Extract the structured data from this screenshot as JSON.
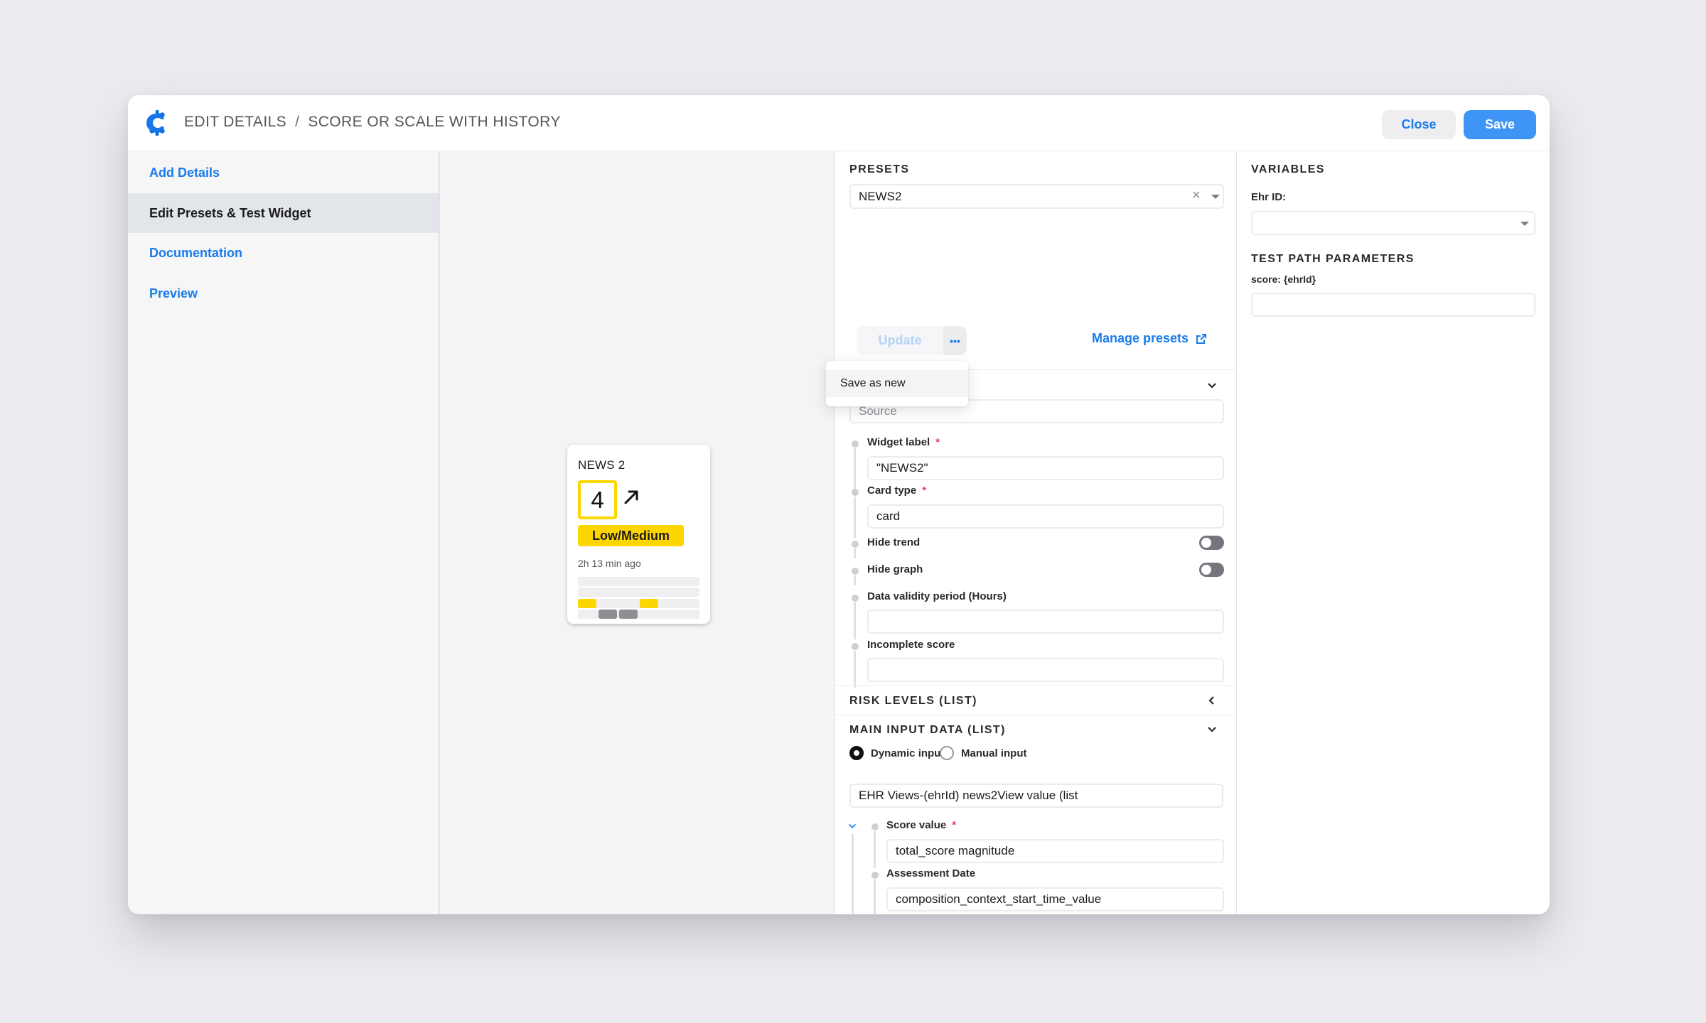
{
  "header": {
    "breadcrumb": [
      "EDIT DETAILS",
      "SCORE OR SCALE WITH HISTORY"
    ],
    "separator": "/",
    "close_label": "Close",
    "save_label": "Save"
  },
  "sidebar": {
    "items": [
      {
        "label": "Add Details",
        "active": false
      },
      {
        "label": "Edit Presets & Test Widget",
        "active": true
      },
      {
        "label": "Documentation",
        "active": false
      },
      {
        "label": "Preview",
        "active": false
      }
    ]
  },
  "preview_card": {
    "title": "NEWS 2",
    "score": "4",
    "trend": "up",
    "risk_label": "Low/Medium",
    "risk_color": "#fdd600",
    "time_ago": "2h 13 min ago",
    "history_marks_color": "#fdd600",
    "history_grey_color": "#8e8f95"
  },
  "presets": {
    "title": "PRESETS",
    "selected": "NEWS2",
    "update_label": "Update",
    "more_label": "•••",
    "manage_label": "Manage presets",
    "menu_items": [
      "Save as new"
    ]
  },
  "config": {
    "source_placeholder": "Source",
    "fields": [
      {
        "label": "Widget label",
        "required": true,
        "value": "\"NEWS2\""
      },
      {
        "label": "Card type",
        "required": true,
        "value": "card"
      }
    ],
    "toggles": [
      {
        "label": "Hide trend",
        "on": false
      },
      {
        "label": "Hide graph",
        "on": false
      }
    ],
    "data_validity_label": "Data validity period (Hours)",
    "data_validity_value": "",
    "incomplete_score_label": "Incomplete score",
    "incomplete_score_value": "",
    "risk_levels_title": "RISK LEVELS (LIST)",
    "main_input_title": "MAIN INPUT DATA (LIST)",
    "radio_options": [
      {
        "label": "Dynamic input",
        "selected": true
      },
      {
        "label": "Manual input",
        "selected": false
      }
    ],
    "main_input_value": "EHR Views-(ehrId) news2View value (list",
    "score_value_label": "Score value",
    "score_value": "total_score magnitude",
    "assessment_date_label": "Assessment Date",
    "assessment_date_value": "composition_context_start_time_value"
  },
  "variables": {
    "title": "VARIABLES",
    "ehr_id_label": "Ehr ID:",
    "ehr_id_value": "",
    "test_path_title": "TEST PATH PARAMETERS",
    "score_param_label": "score: {ehrId}",
    "score_param_value": ""
  },
  "colors": {
    "accent": "#1a7bea",
    "save_button": "#3f95f5",
    "required": "#f0386b"
  }
}
